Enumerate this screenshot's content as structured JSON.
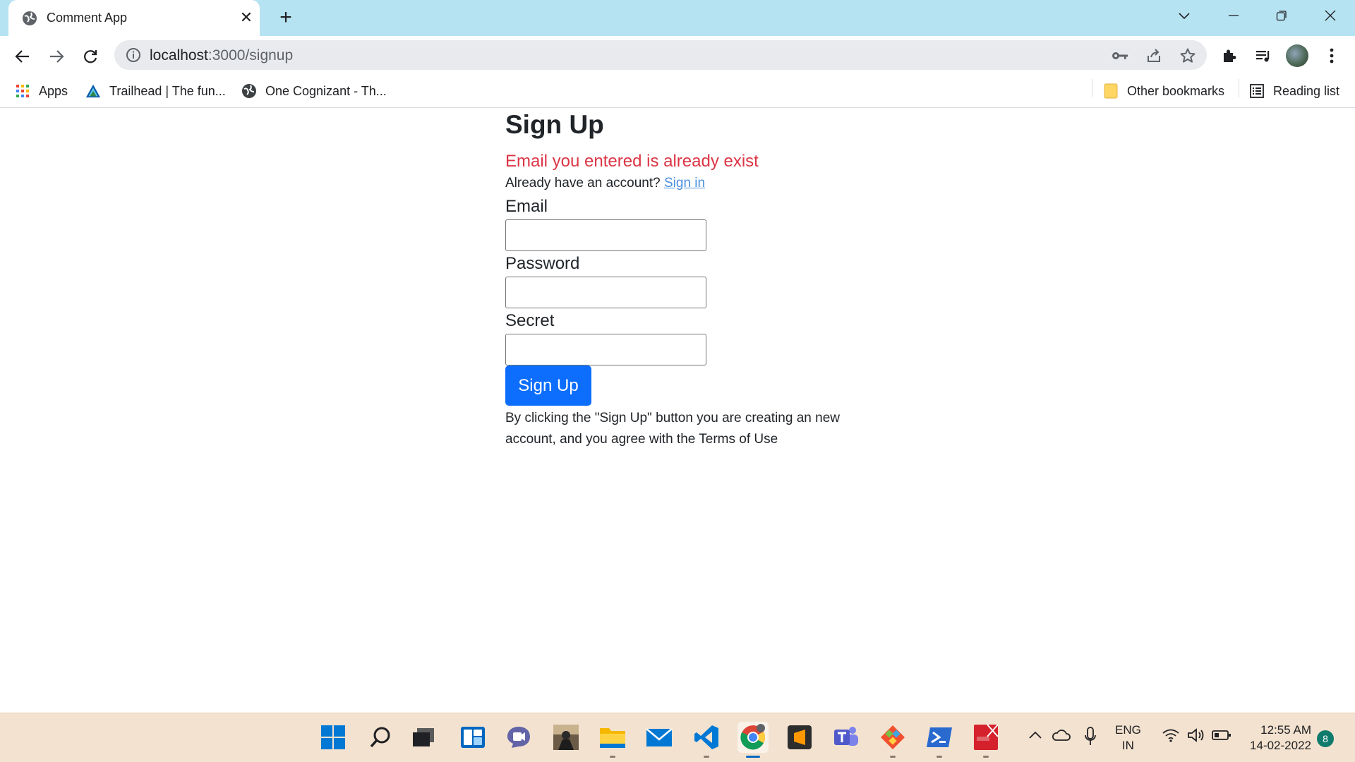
{
  "browser": {
    "tab": {
      "title": "Comment App",
      "close_glyph": "✕"
    },
    "new_tab_glyph": "+",
    "window_controls": {
      "menu": "chevron-down-icon",
      "minimize": "minimize-icon",
      "restore": "restore-icon",
      "close": "close-icon"
    },
    "address": {
      "host": "localhost",
      "path": ":3000/signup"
    }
  },
  "bookmarks": {
    "items": [
      {
        "label": "Apps",
        "icon": "apps-grid-icon"
      },
      {
        "label": "Trailhead | The fun...",
        "icon": "trailhead-icon"
      },
      {
        "label": "One Cognizant - Th...",
        "icon": "globe-icon"
      }
    ],
    "other": "Other bookmarks",
    "reading_list": "Reading list"
  },
  "page": {
    "title": "Sign Up",
    "error": "Email you entered is already exist",
    "signin_prompt": "Already have an account?",
    "signin_link": "Sign in",
    "fields": {
      "email_label": "Email",
      "password_label": "Password",
      "secret_label": "Secret"
    },
    "submit_label": "Sign Up",
    "terms": "By clicking the \"Sign Up\" button you are creating an new account, and you agree with the Terms of Use"
  },
  "taskbar": {
    "apps": [
      "start-icon",
      "search-icon",
      "task-view-icon",
      "widgets-icon",
      "chat-icon",
      "game-icon",
      "file-explorer-icon",
      "mail-icon",
      "vscode-icon",
      "chrome-icon",
      "sublime-icon",
      "teams-icon",
      "git-icon",
      "powershell-icon",
      "pdf-icon"
    ],
    "language": {
      "line1": "ENG",
      "line2": "IN"
    },
    "time": "12:55 AM",
    "date": "14-02-2022",
    "notifications": "8"
  }
}
